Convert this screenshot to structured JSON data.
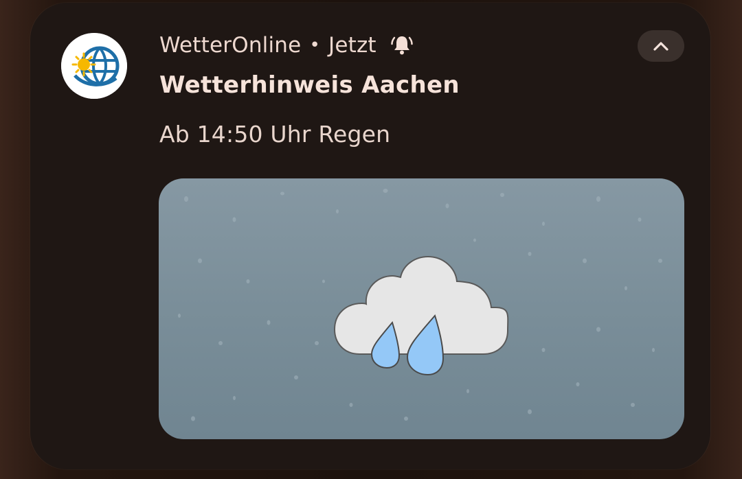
{
  "notification": {
    "app_name": "WetterOnline",
    "separator": "•",
    "time": "Jetzt",
    "title": "Wetterhinweis Aachen",
    "body": "Ab 14:50 Uhr Regen"
  },
  "icons": {
    "app": "wetteronline-logo-icon",
    "alert": "bell-ringing-icon",
    "collapse": "chevron-up-icon",
    "weather": "rain-cloud-icon"
  },
  "colors": {
    "card_background": "#1f1714",
    "text_primary": "#f6e3da",
    "button_background": "#3a302c",
    "image_background": "#7d919c",
    "cloud": "#e6e6e6",
    "raindrop": "#94c8f7",
    "logo_blue": "#1e6fa8",
    "sun": "#f6b800"
  }
}
